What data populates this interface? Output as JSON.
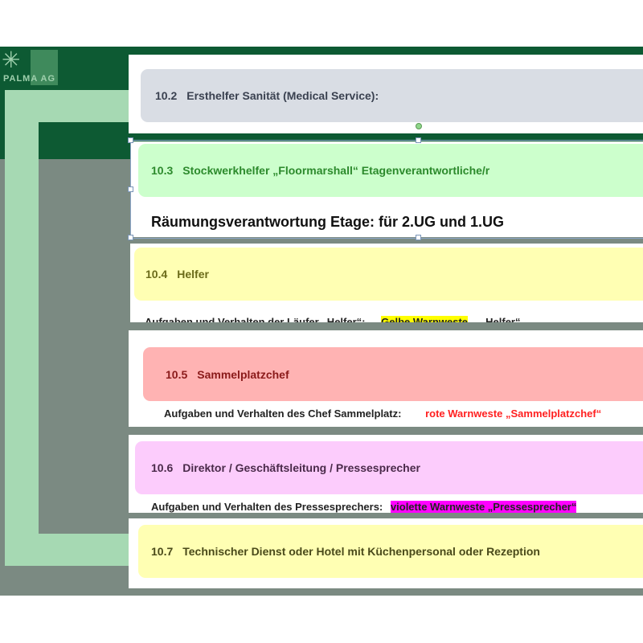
{
  "logo": {
    "text": "PALMA AG",
    "glyph": "✳"
  },
  "slides": [
    {
      "number": "10.2",
      "title": "Ersthelfer Sanität (Medical Service):",
      "color": "#d9dde4",
      "text_color": "#3a4150"
    },
    {
      "number": "10.3",
      "title": "Stockwerkhelfer „Floormarshall“ Etagenverantwortliche/r",
      "color": "#ccffcc",
      "text_color": "#2c8a2c",
      "subtitle": "Räumungsverantwortung Etage: für 2.UG und 1.UG"
    },
    {
      "number": "10.4",
      "title": "Helfer",
      "color": "#ffffb3",
      "text_color": "#6b6b1a",
      "body_prefix": "Aufgaben und Verhalten der Läufer „Helfer“:",
      "body_highlight": "Gelbe Warnweste",
      "body_suffix": "„Helfer“",
      "highlight_color": "#ffff00"
    },
    {
      "number": "10.5",
      "title": "Sammelplatzchef",
      "color": "#ffb3b3",
      "text_color": "#8a1a1a",
      "body_prefix": "Aufgaben und Verhalten des Chef Sammelplatz:",
      "body_highlight": "rote Warnweste „Sammelplatzchef“",
      "highlight_color": "#ff2020"
    },
    {
      "number": "10.6",
      "title": "Direktor / Geschäftsleitung / Pressesprecher",
      "color": "#fcccfc",
      "text_color": "#4a2a4a",
      "body_prefix": "Aufgaben und Verhalten des Pressesprechers:",
      "body_highlight": "violette Warnweste „Pressesprecher“",
      "highlight_color": "#ff00ff"
    },
    {
      "number": "10.7",
      "title": "Technischer Dienst oder Hotel mit Küchenpersonal oder Rezeption",
      "color": "#ffffb3",
      "text_color": "#4a4a1a"
    }
  ]
}
